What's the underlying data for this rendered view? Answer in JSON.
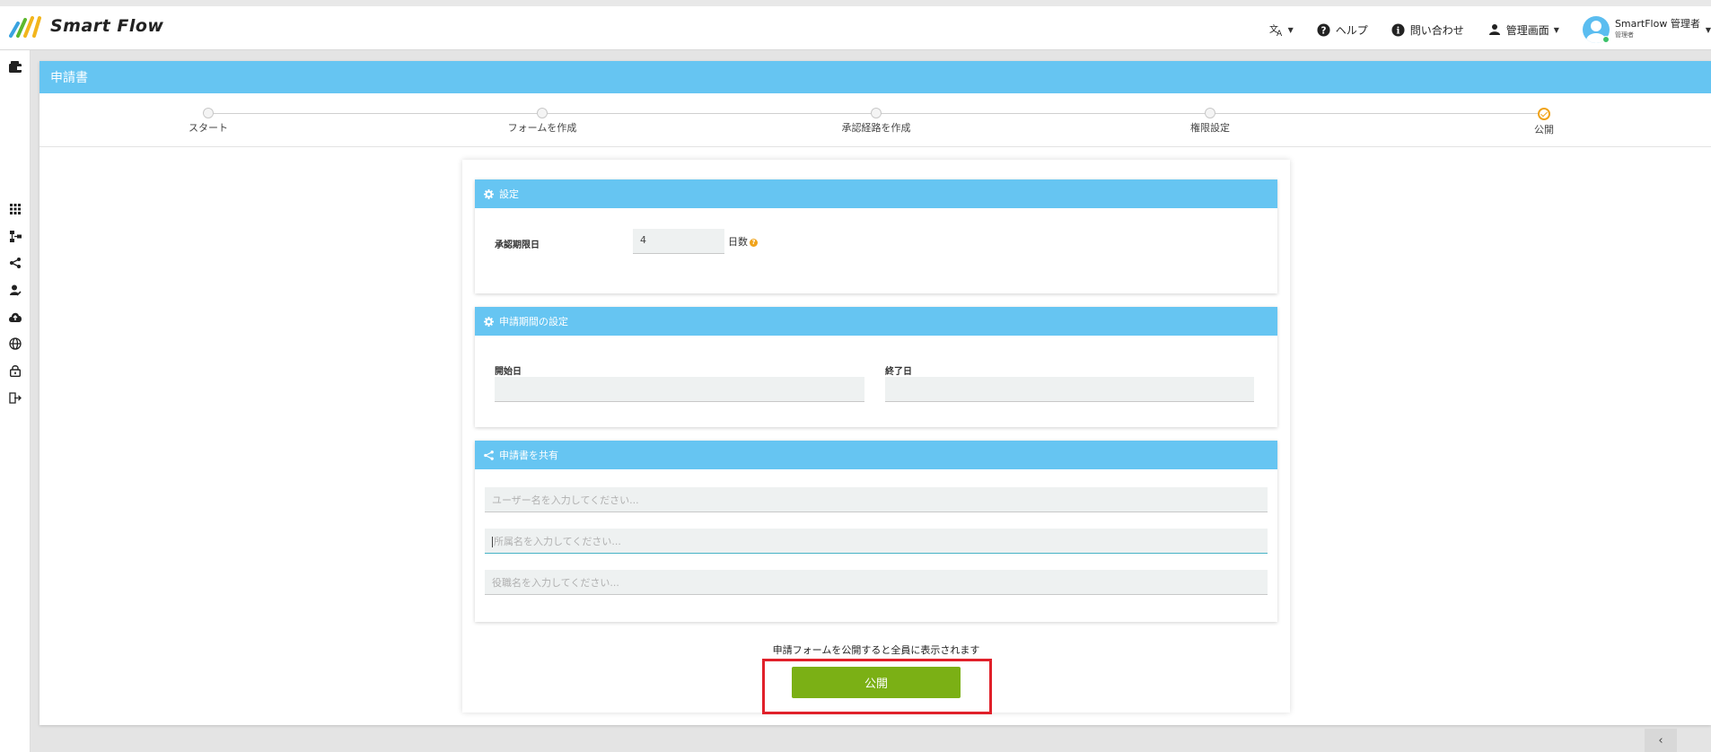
{
  "app": {
    "brand": "Smart Flow",
    "colors": {
      "accent": "#66c5f2",
      "publish": "#7bb015",
      "highlight": "#e0202a",
      "step_active": "#f0a31a"
    }
  },
  "header": {
    "language_icon": "translate-icon",
    "help_label": "ヘルプ",
    "contact_label": "問い合わせ",
    "admin_label": "管理画面",
    "user_name": "SmartFlow 管理者",
    "user_role": "管理者"
  },
  "sidebar": {
    "icons": [
      "wallet-icon",
      "grid-icon",
      "flow-icon",
      "share-icon",
      "user-edit-icon",
      "cloud-upload-icon",
      "globe-icon",
      "lock-icon",
      "logout-icon"
    ]
  },
  "page": {
    "title": "申請書"
  },
  "stepper": {
    "steps": [
      {
        "label": "スタート",
        "state": "done"
      },
      {
        "label": "フォームを作成",
        "state": "done"
      },
      {
        "label": "承認経路を作成",
        "state": "done"
      },
      {
        "label": "権限設定",
        "state": "done"
      },
      {
        "label": "公開",
        "state": "active"
      }
    ]
  },
  "settings": {
    "title": "設定",
    "deadline_label": "承認期限日",
    "deadline_value": "4",
    "deadline_unit": "日数",
    "help_glyph": "?"
  },
  "period": {
    "title": "申請期間の設定",
    "start_label": "開始日",
    "start_value": "",
    "end_label": "終了日",
    "end_value": ""
  },
  "share": {
    "title": "申請書を共有",
    "user_placeholder": "ユーザー名を入力してください...",
    "dept_placeholder": "所属名を入力してください...",
    "role_placeholder": "役職名を入力してください..."
  },
  "publish": {
    "notice": "申請フォームを公開すると全員に表示されます",
    "button_label": "公開"
  },
  "collapse": {
    "label": "‹"
  }
}
